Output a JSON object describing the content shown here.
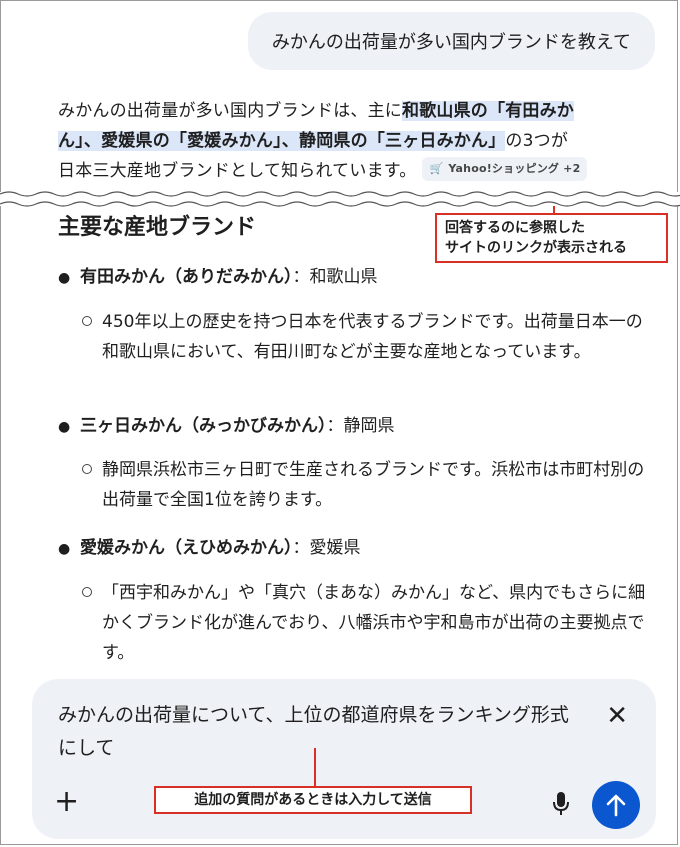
{
  "user_message": "みかんの出荷量が多い国内ブランドを教えて",
  "answer": {
    "intro_1": "みかんの出荷量が多い国内ブランドは、主に",
    "intro_hl_1": "和歌山県の「有田みか",
    "intro_hl_2": "ん」、愛媛県の「愛媛みかん」、静岡県の「三ヶ日みかん」",
    "intro_2": "の3つが",
    "intro_3": "日本三大産地ブランドとして知られています。",
    "source_chip": "Yahoo!ショッピング +2",
    "source_chip_icon": "cart-icon"
  },
  "callouts": {
    "sources": [
      "回答するのに参照した",
      "サイトのリンクが表示される"
    ],
    "followup": "追加の質問があるときは入力して送信"
  },
  "section_title": "主要な産地ブランド",
  "brands": [
    {
      "name": "有田みかん（ありだみかん）",
      "region": "：和歌山県",
      "desc": "450年以上の歴史を持つ日本を代表するブランドです。出荷量日本一の和歌山県において、有田川町などが主要な産地となっています。"
    },
    {
      "name": "三ヶ日みかん（みっかびみかん）",
      "region": "：静岡県",
      "desc": "静岡県浜松市三ヶ日町で生産されるブランドです。浜松市は市町村別の出荷量で全国1位を誇ります。"
    },
    {
      "name": "愛媛みかん（えひめみかん）",
      "region": "：愛媛県",
      "desc": "「西宇和みかん」や「真穴（まあな）みかん」など、県内でもさらに細かくブランド化が進んでおり、八幡浜市や宇和島市が出荷の主要拠点です。"
    }
  ],
  "input": {
    "value": "みかんの出荷量について、上位の都道府県をランキング形式にして",
    "icons": [
      "close-icon",
      "plus-icon",
      "microphone-icon",
      "send-arrow-icon"
    ]
  },
  "colors": {
    "accent": "#0b57d0",
    "highlight": "#dbe6f9",
    "callout": "#d93025",
    "bubble": "#eef1f6"
  }
}
